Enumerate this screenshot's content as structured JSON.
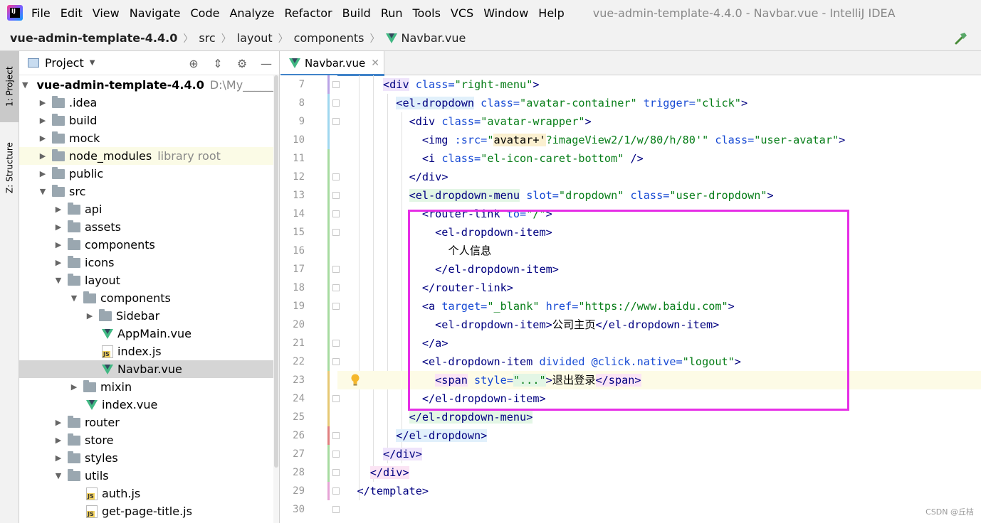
{
  "menubar": {
    "items": [
      "File",
      "Edit",
      "View",
      "Navigate",
      "Code",
      "Analyze",
      "Refactor",
      "Build",
      "Run",
      "Tools",
      "VCS",
      "Window",
      "Help"
    ],
    "window_title": "vue-admin-template-4.4.0 - Navbar.vue - IntelliJ IDEA"
  },
  "breadcrumb": {
    "items": [
      "vue-admin-template-4.4.0",
      "src",
      "layout",
      "components",
      "Navbar.vue"
    ]
  },
  "toolstrip": {
    "project_tab": "1: Project",
    "structure_tab": "Z: Structure"
  },
  "project_panel": {
    "title": "Project",
    "tree": [
      {
        "label": "vue-admin-template-4.4.0",
        "extra": "D:\\My___________"
      },
      {
        "label": ".idea"
      },
      {
        "label": "build"
      },
      {
        "label": "mock"
      },
      {
        "label": "node_modules",
        "extra": "library root"
      },
      {
        "label": "public"
      },
      {
        "label": "src"
      },
      {
        "label": "api"
      },
      {
        "label": "assets"
      },
      {
        "label": "components"
      },
      {
        "label": "icons"
      },
      {
        "label": "layout"
      },
      {
        "label": "components"
      },
      {
        "label": "Sidebar"
      },
      {
        "label": "AppMain.vue"
      },
      {
        "label": "index.js"
      },
      {
        "label": "Navbar.vue"
      },
      {
        "label": "mixin"
      },
      {
        "label": "index.vue"
      },
      {
        "label": "router"
      },
      {
        "label": "store"
      },
      {
        "label": "styles"
      },
      {
        "label": "utils"
      },
      {
        "label": "auth.js"
      },
      {
        "label": "get-page-title.js"
      }
    ]
  },
  "editor": {
    "tab_label": "Navbar.vue",
    "line_numbers": [
      "7",
      "8",
      "9",
      "10",
      "11",
      "12",
      "13",
      "14",
      "15",
      "16",
      "17",
      "18",
      "19",
      "20",
      "21",
      "22",
      "23",
      "24",
      "25",
      "26",
      "27",
      "28",
      "29",
      "30"
    ],
    "code": {
      "l7_tag": "<div",
      "l7_attr": " class=",
      "l7_val": "\"right-menu\"",
      "l7_end": ">",
      "l8_tag": "<el-dropdown",
      "l8_attr": " class=",
      "l8_val": "\"avatar-container\"",
      "l8_attr2": " trigger=",
      "l8_val2": "\"click\"",
      "l8_end": ">",
      "l9_tag": "<div",
      "l9_attr": " class=",
      "l9_val": "\"avatar-wrapper\"",
      "l9_end": ">",
      "l10_tag": "<img",
      "l10_attr": " :src=",
      "l10_q": "\"",
      "l10_expr": "avatar+'",
      "l10_val": "?imageView2/1/w/80/h/80'\"",
      "l10_attr2": " class=",
      "l10_val2": "\"user-avatar\"",
      "l10_end": ">",
      "l11_tag": "<i",
      "l11_attr": " class=",
      "l11_val": "\"el-icon-caret-bottom\"",
      "l11_end": " />",
      "l12_tag": "</div",
      "l12_end": ">",
      "l13_tag": "<el-dropdown-menu",
      "l13_attr": " slot=",
      "l13_val": "\"dropdown\"",
      "l13_attr2": " class=",
      "l13_val2": "\"user-dropdown\"",
      "l13_end": ">",
      "l14_tag": "<router-link",
      "l14_attr": " to=",
      "l14_val": "\"/\"",
      "l14_end": ">",
      "l15_tag": "<el-dropdown-item",
      "l15_end": ">",
      "l16_text": "个人信息",
      "l17_tag": "</el-dropdown-item",
      "l17_end": ">",
      "l18_tag": "</router-link",
      "l18_end": ">",
      "l19_tag": "<a",
      "l19_attr": " target=",
      "l19_val": "\"_blank\"",
      "l19_attr2": " href=",
      "l19_val2": "\"https://www.baidu.com\"",
      "l19_end": ">",
      "l20_tag": "<el-dropdown-item",
      "l20_end": ">",
      "l20_text": "公司主页",
      "l20_tag2": "</el-dropdown-item",
      "l20_end2": ">",
      "l21_tag": "</a",
      "l21_end": ">",
      "l22_tag": "<el-dropdown-item",
      "l22_attr": " divided @click.native=",
      "l22_val": "\"logout\"",
      "l22_end": ">",
      "l23_tag": "<span",
      "l23_attr": " style=",
      "l23_val": "\"...\"",
      "l23_end": ">",
      "l23_text": "退出登录",
      "l23_tag2": "</span",
      "l23_end2": ">",
      "l24_tag": "</el-dropdown-item",
      "l24_end": ">",
      "l25_tag": "</el-dropdown-menu",
      "l25_end": ">",
      "l26_tag": "</el-dropdown",
      "l26_end": ">",
      "l27_tag": "</div",
      "l27_end": ">",
      "l28_tag": "</div",
      "l28_end": ">",
      "l29_tag": "</template",
      "l29_end": ">"
    }
  },
  "watermark": "CSDN @丘桔",
  "colors": {
    "highlight_box": "#e62ee6",
    "tag": "#000080",
    "attribute": "#174ad4",
    "string": "#067d17"
  }
}
